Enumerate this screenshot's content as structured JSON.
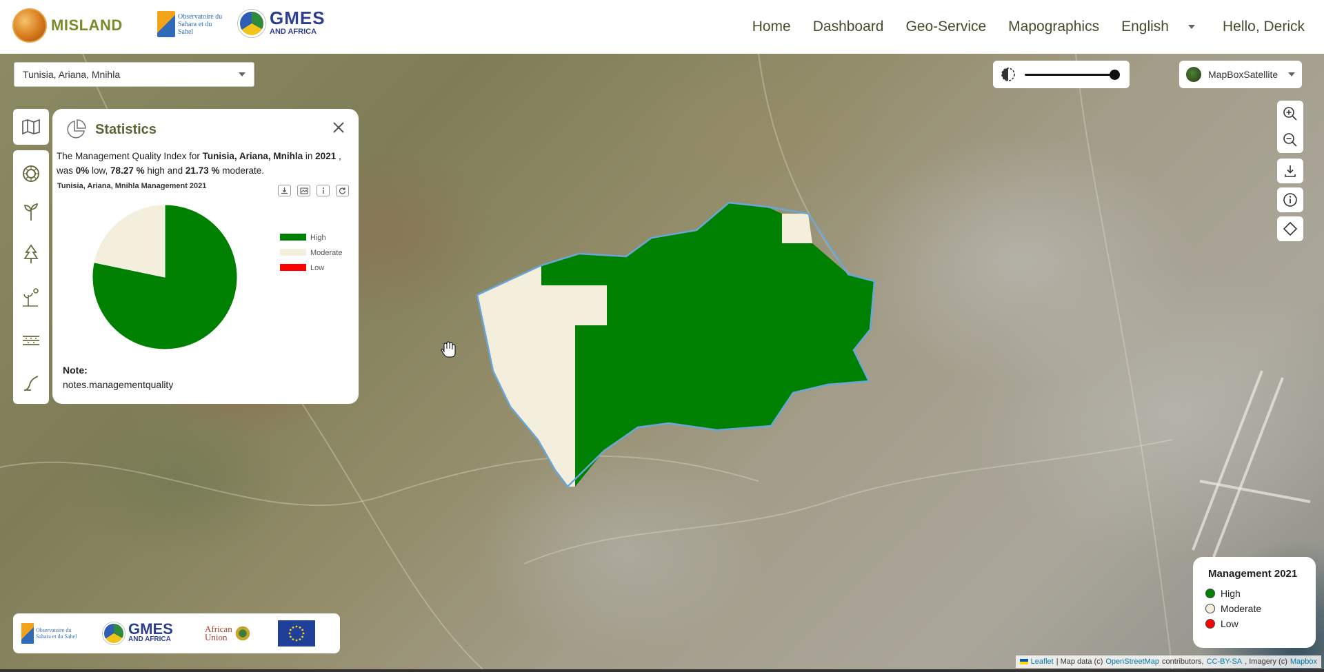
{
  "header": {
    "brand": "MISLAND",
    "oss_logo_text": "Observatoire du Sahara et du Sahel",
    "gmes_logo_big": "GMES",
    "gmes_logo_small": "AND AFRICA",
    "nav": [
      {
        "label": "Home"
      },
      {
        "label": "Dashboard"
      },
      {
        "label": "Geo-Service"
      },
      {
        "label": "Mapographics"
      }
    ],
    "language": "English",
    "greeting": "Hello, Derick"
  },
  "location_select": {
    "value": "Tunisia, Ariana, Mnihla"
  },
  "left_toolbar": {
    "icons": [
      "map-icon",
      "sun-icon",
      "sprout-icon",
      "tree-icon",
      "weather-icon",
      "layers-icon",
      "erosion-icon"
    ]
  },
  "statistics": {
    "title": "Statistics",
    "summary": {
      "prefix": "The Management Quality Index for ",
      "place": "Tunisia, Ariana, Mnihla",
      "in": " in ",
      "year": "2021",
      "was": " , was ",
      "low": "0%",
      "low_text": " low, ",
      "high": "78.27 %",
      "high_text": " high and ",
      "moderate": "21.73 %",
      "moderate_text": " moderate."
    },
    "note_label": "Note:",
    "note_text": "notes.managementquality"
  },
  "chart_data": {
    "type": "pie",
    "title": "Tunisia, Ariana, Mnihla Management 2021",
    "categories": [
      "High",
      "Moderate",
      "Low"
    ],
    "values": [
      78.27,
      21.73,
      0
    ],
    "colors": [
      "#008000",
      "#f3efdc",
      "#ff0000"
    ],
    "legend": "right"
  },
  "controls": {
    "basemap": "MapBoxSatellite",
    "contrast_level": 1.0
  },
  "map_legend": {
    "title": "Management 2021",
    "items": [
      {
        "label": "High",
        "color": "#008000"
      },
      {
        "label": "Moderate",
        "color": "#f3efdc"
      },
      {
        "label": "Low",
        "color": "#ff0000"
      }
    ]
  },
  "partners": {
    "oss": "Observatoire du Sahara et du Sahel",
    "gmes_big": "GMES",
    "gmes_small": "AND AFRICA",
    "au_line1": "African",
    "au_line2": "Union"
  },
  "attribution": {
    "leaflet": "Leaflet",
    "map_data": "| Map data (c)",
    "osm": "OpenStreetMap",
    "contributors": "contributors,",
    "license": "CC-BY-SA",
    "imagery": ", Imagery (c)",
    "mapbox": "Mapbox"
  },
  "colors": {
    "high": "#008000",
    "moderate": "#f3efdc",
    "low": "#ff0000",
    "boundary": "#6aa7d8"
  }
}
